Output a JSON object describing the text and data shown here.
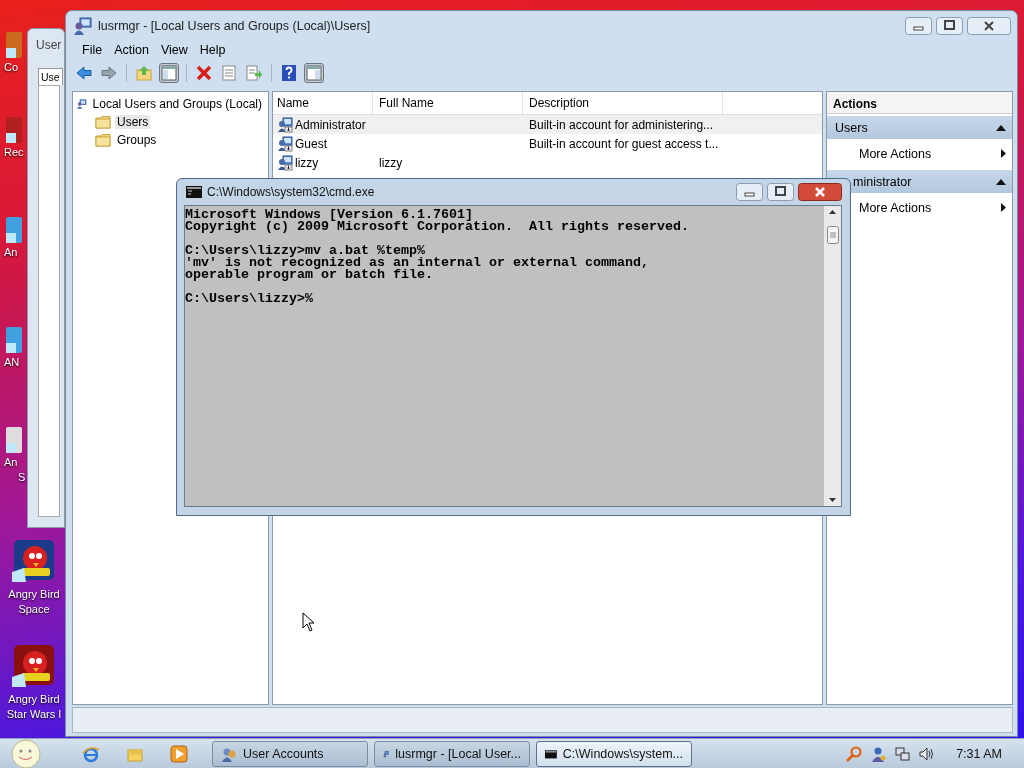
{
  "desktop": {
    "icons": [
      {
        "lines": [
          "Co"
        ]
      },
      {
        "lines": [
          "Rec"
        ]
      },
      {
        "lines": [
          "An"
        ]
      },
      {
        "lines": [
          "AN"
        ]
      },
      {
        "lines": [
          "An",
          "S"
        ]
      },
      {
        "lines": [
          "Angry Bird",
          "Space"
        ]
      },
      {
        "lines": [
          "Angry Bird",
          "Star Wars I"
        ]
      }
    ]
  },
  "background_window": {
    "title": "User",
    "tab": "Use"
  },
  "main_window": {
    "title": "lusrmgr - [Local Users and Groups (Local)\\Users]",
    "menu": [
      "File",
      "Action",
      "View",
      "Help"
    ],
    "toolbar": [
      {
        "kind": "back",
        "pressed": false
      },
      {
        "kind": "forward",
        "pressed": false
      },
      {
        "kind": "up",
        "pressed": false
      },
      {
        "kind": "tree",
        "pressed": true
      },
      {
        "kind": "delete",
        "pressed": false
      },
      {
        "kind": "properties",
        "pressed": false
      },
      {
        "kind": "export",
        "pressed": false
      },
      {
        "kind": "help",
        "pressed": false
      },
      {
        "kind": "actionpane",
        "pressed": true
      }
    ],
    "tree": {
      "root": "Local Users and Groups (Local)",
      "children": [
        {
          "label": "Users",
          "selected": true
        },
        {
          "label": "Groups",
          "selected": false
        }
      ]
    },
    "table": {
      "columns": [
        "Name",
        "Full Name",
        "Description"
      ],
      "rows": [
        {
          "name": "Administrator",
          "description": "Built-in account for administering...",
          "selected": true
        },
        {
          "name": "Guest",
          "description": "Built-in account for guest access t...",
          "selected": false
        },
        {
          "name": "lizzy",
          "full_name": "lizzy",
          "selected": false
        }
      ]
    },
    "actions": {
      "title": "Actions",
      "sections": [
        {
          "title": "Users",
          "items": [
            "More Actions"
          ]
        },
        {
          "title": "ministrator",
          "items": [
            "More Actions"
          ]
        }
      ]
    }
  },
  "console": {
    "title": "C:\\Windows\\system32\\cmd.exe",
    "paragraphs": [
      [
        "Microsoft Windows [Version 6.1.7601]",
        "Copyright (c) 2009 Microsoft Corporation.  All rights reserved."
      ],
      [
        "C:\\Users\\lizzy>mv a.bat %temp%",
        "'mv' is not recognized as an internal or external command,",
        "operable program or batch file."
      ],
      [
        "C:\\Users\\lizzy>%"
      ]
    ]
  },
  "taskbar": {
    "tasks": [
      {
        "label": "User Accounts",
        "selected": false
      },
      {
        "label": "lusrmgr - [Local User...",
        "selected": false
      },
      {
        "label": "C:\\Windows\\system...",
        "selected": true
      }
    ],
    "clock": "7:31 AM"
  }
}
